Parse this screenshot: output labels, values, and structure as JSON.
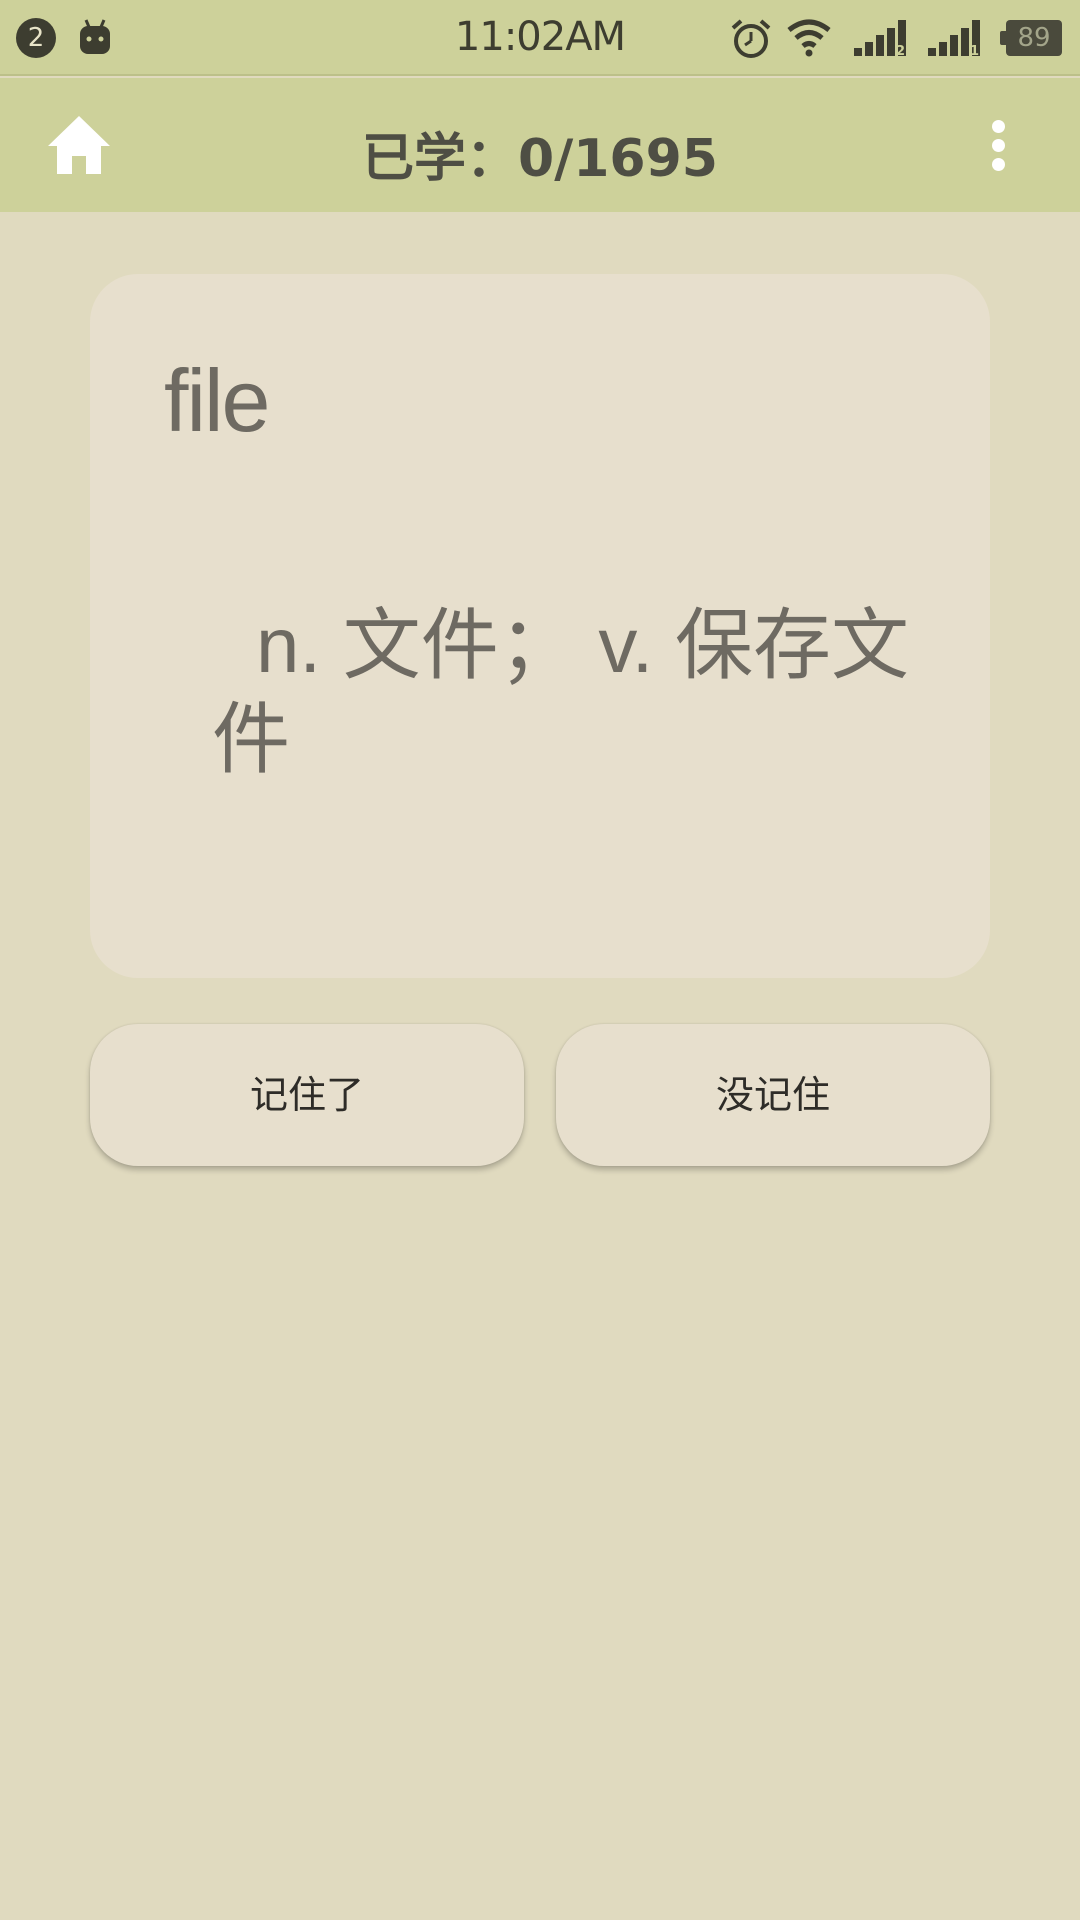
{
  "status_bar": {
    "notification_count": "2",
    "time": "11:02AM",
    "battery_level": "89",
    "sim1_label": "2",
    "sim2_label": "1"
  },
  "header": {
    "title": "已学：0/1695",
    "home_icon": "home-icon",
    "menu_icon": "more-vert-icon"
  },
  "card": {
    "word": "file",
    "definition": "n. 文件； v. 保存文件"
  },
  "actions": {
    "remembered_label": "记住了",
    "forgot_label": "没记住"
  },
  "colors": {
    "toolbar": "#cdd19a",
    "background": "#e0dabf",
    "card": "#e7dfcd"
  }
}
